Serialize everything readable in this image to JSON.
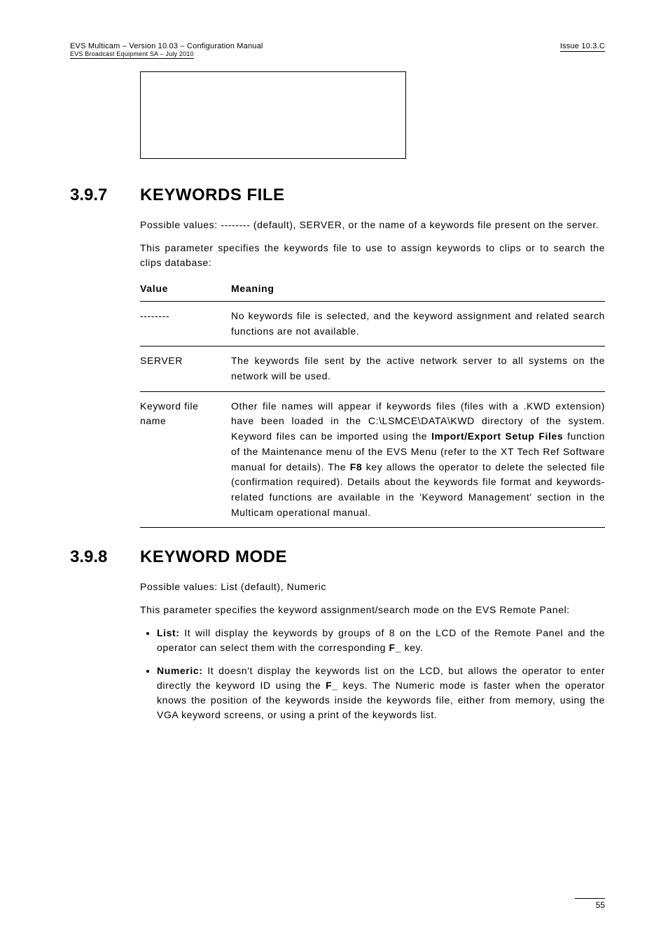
{
  "header": {
    "left_main": "EVS Multicam – Version 10.03 – Configuration Manual",
    "left_sub": "EVS Broadcast Equipment SA – July  2010",
    "right": "Issue 10.3.C"
  },
  "section1": {
    "num": "3.9.7",
    "title": "KEYWORDS FILE",
    "intro1": "Possible values: -------- (default), SERVER, or the name of a keywords file present on the server.",
    "intro2": "This parameter specifies the keywords file to use to assign keywords to clips or to search the clips database:",
    "th_value": "Value",
    "th_meaning": "Meaning",
    "rows": [
      {
        "value": "--------",
        "meaning": "No keywords file is selected, and the keyword assignment and related search functions are not available."
      },
      {
        "value": "SERVER",
        "meaning": "The keywords file sent by the active network server to all systems on the network will be used."
      },
      {
        "value": "Keyword file name",
        "meaning_pre": "Other file names will appear if keywords files (files with a .KWD extension) have been loaded in the C:\\LSMCE\\DATA\\KWD directory of the system. Keyword files can be imported using the ",
        "bold1": "Import/Export Setup Files",
        "meaning_mid1": " function of the Maintenance menu of the EVS Menu (refer to the XT Tech Ref Software manual for details). The ",
        "bold2": "F8",
        "meaning_post": " key allows the operator to delete the selected file (confirmation required). Details about the keywords file format and keywords-related functions are available in the 'Keyword Management' section in the Multicam operational manual."
      }
    ]
  },
  "section2": {
    "num": "3.9.8",
    "title": "KEYWORD MODE",
    "intro1": "Possible values: List (default), Numeric",
    "intro2": "This parameter specifies the keyword assignment/search mode on the EVS Remote Panel:",
    "bullets": [
      {
        "lead": "List:",
        "text_pre": " It will display the keywords by groups of 8 on the LCD of the Remote Panel and the operator can select them with the corresponding ",
        "bold_mid": "F_",
        "text_post": " key."
      },
      {
        "lead": "Numeric:",
        "text_pre": " It doesn't display the keywords list on the LCD, but allows the operator to enter directly the keyword ID using the ",
        "bold_mid": "F_",
        "text_post": " keys. The Numeric mode is faster when the operator knows the position of the keywords inside the keywords file, either from memory, using the VGA keyword screens, or using a print of the keywords list."
      }
    ]
  },
  "footer": {
    "page": "55"
  }
}
